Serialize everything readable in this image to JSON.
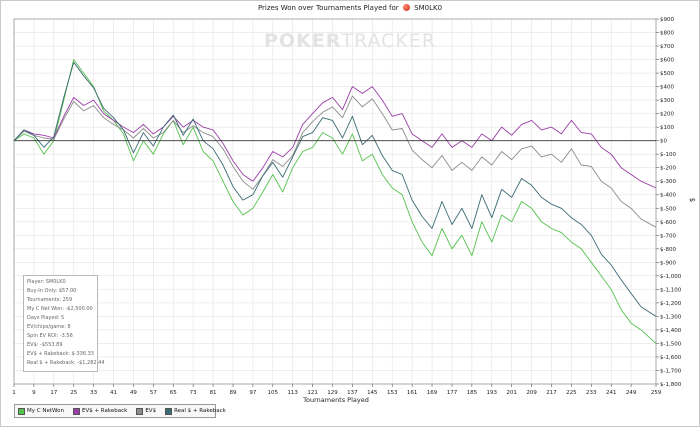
{
  "title": "Prizes Won over Tournaments Played for",
  "player_name": "SM0LK0",
  "watermark": {
    "part1": "POKER",
    "part2": "TRACKER"
  },
  "y_axis_label": "$",
  "x_axis_label": "Tournaments Played",
  "info_box": [
    "Player: SM0LK0",
    "Buy-In Only: $57.00",
    "Tournaments: 259",
    "My C Net Won: -$2,500.00",
    "Days Played: 5",
    "EV/chips/game: 8",
    "Spin EV ROI: -3.56",
    "EV$: -$553.89",
    "EV$ + Rakeback: $-336.33",
    "Real $ + Rakeback: -$1,282.44"
  ],
  "colors": {
    "green": "#55c24e",
    "purple": "#9a3ea6",
    "gray": "#8c8c8c",
    "teal": "#3a6a74",
    "zero_line": "#333333",
    "grid": "#e3e3e3"
  },
  "chart_data": {
    "type": "line",
    "title": "Prizes Won over Tournaments Played for SM0LK0",
    "xlabel": "Tournaments Played",
    "ylabel": "$",
    "xlim": [
      1,
      259
    ],
    "ylim": [
      -1800,
      900
    ],
    "x_ticks": [
      1,
      9,
      17,
      25,
      33,
      41,
      49,
      57,
      65,
      73,
      81,
      89,
      97,
      105,
      113,
      121,
      129,
      137,
      145,
      153,
      161,
      169,
      177,
      185,
      193,
      201,
      209,
      217,
      225,
      233,
      241,
      249,
      259
    ],
    "y_ticks": [
      900,
      800,
      700,
      600,
      500,
      400,
      300,
      200,
      100,
      0,
      -100,
      -200,
      -300,
      -400,
      -500,
      -600,
      -700,
      -800,
      -900,
      -1000,
      -1100,
      -1200,
      -1300,
      -1400,
      -1500,
      -1600,
      -1700,
      -1800
    ],
    "y_tick_labels": [
      "$900",
      "$800",
      "$700",
      "$600",
      "$500",
      "$400",
      "$300",
      "$200",
      "$100",
      "$0",
      "$-100",
      "$-200",
      "$-300",
      "$-400",
      "$-500",
      "$-600",
      "$-700",
      "$-800",
      "$-900",
      "$-1,000",
      "$-1,100",
      "$-1,200",
      "$-1,300",
      "$-1,400",
      "$-1,500",
      "$-1,600",
      "$-1,700",
      "$-1,800"
    ],
    "grid": true,
    "legend_position": "bottom-left",
    "series": [
      {
        "name": "My C NetWon",
        "color": "#55c24e",
        "x": [
          1,
          5,
          9,
          13,
          17,
          21,
          25,
          29,
          33,
          37,
          41,
          45,
          49,
          53,
          57,
          61,
          65,
          69,
          73,
          77,
          81,
          85,
          89,
          93,
          97,
          101,
          105,
          109,
          113,
          117,
          121,
          125,
          129,
          133,
          137,
          141,
          145,
          149,
          153,
          157,
          161,
          165,
          169,
          173,
          177,
          181,
          185,
          189,
          193,
          197,
          201,
          205,
          209,
          213,
          217,
          221,
          225,
          229,
          233,
          237,
          241,
          245,
          249,
          253,
          259
        ],
        "y": [
          0,
          50,
          20,
          -100,
          0,
          300,
          600,
          500,
          400,
          220,
          150,
          50,
          -150,
          0,
          -100,
          50,
          150,
          -30,
          100,
          -80,
          -150,
          -300,
          -450,
          -550,
          -500,
          -380,
          -250,
          -380,
          -200,
          -80,
          -50,
          60,
          20,
          -100,
          50,
          -150,
          -100,
          -250,
          -350,
          -400,
          -600,
          -750,
          -850,
          -650,
          -800,
          -700,
          -850,
          -600,
          -750,
          -550,
          -600,
          -450,
          -500,
          -600,
          -650,
          -680,
          -750,
          -800,
          -900,
          -1000,
          -1100,
          -1250,
          -1350,
          -1400,
          -1500
        ]
      },
      {
        "name": "EV$ + Rakeback",
        "color": "#9a3ea6",
        "x": [
          1,
          5,
          9,
          13,
          17,
          21,
          25,
          29,
          33,
          37,
          41,
          45,
          49,
          53,
          57,
          61,
          65,
          69,
          73,
          77,
          81,
          85,
          89,
          93,
          97,
          101,
          105,
          109,
          113,
          117,
          121,
          125,
          129,
          133,
          137,
          141,
          145,
          149,
          153,
          157,
          161,
          165,
          169,
          173,
          177,
          181,
          185,
          189,
          193,
          197,
          201,
          205,
          209,
          213,
          217,
          221,
          225,
          229,
          233,
          237,
          241,
          245,
          249,
          253,
          259
        ],
        "y": [
          0,
          80,
          50,
          40,
          20,
          180,
          320,
          260,
          300,
          200,
          150,
          100,
          60,
          120,
          50,
          100,
          180,
          100,
          150,
          100,
          80,
          -20,
          -150,
          -250,
          -300,
          -200,
          -80,
          -120,
          -50,
          120,
          200,
          280,
          320,
          230,
          400,
          350,
          400,
          300,
          180,
          200,
          50,
          0,
          -50,
          50,
          -50,
          0,
          -50,
          50,
          0,
          100,
          40,
          120,
          150,
          80,
          100,
          50,
          150,
          60,
          50,
          -50,
          -100,
          -200,
          -250,
          -300,
          -350
        ]
      },
      {
        "name": "EV$",
        "color": "#8c8c8c",
        "x": [
          1,
          5,
          9,
          13,
          17,
          21,
          25,
          29,
          33,
          37,
          41,
          45,
          49,
          53,
          57,
          61,
          65,
          69,
          73,
          77,
          81,
          85,
          89,
          93,
          97,
          101,
          105,
          109,
          113,
          117,
          121,
          125,
          129,
          133,
          137,
          141,
          145,
          149,
          153,
          157,
          161,
          165,
          169,
          173,
          177,
          181,
          185,
          189,
          193,
          197,
          201,
          205,
          209,
          213,
          217,
          221,
          225,
          229,
          233,
          237,
          241,
          245,
          249,
          253,
          259
        ],
        "y": [
          0,
          70,
          40,
          20,
          10,
          160,
          290,
          220,
          260,
          170,
          120,
          80,
          20,
          90,
          20,
          60,
          150,
          60,
          110,
          60,
          30,
          -60,
          -190,
          -300,
          -360,
          -260,
          -140,
          -190,
          -110,
          60,
          140,
          210,
          250,
          170,
          330,
          250,
          310,
          200,
          80,
          90,
          -70,
          -140,
          -200,
          -110,
          -220,
          -160,
          -220,
          -120,
          -180,
          -80,
          -140,
          -60,
          -40,
          -120,
          -100,
          -160,
          -60,
          -180,
          -190,
          -300,
          -350,
          -450,
          -500,
          -580,
          -640
        ]
      },
      {
        "name": "Real $ + Rakeback",
        "color": "#3a6a74",
        "x": [
          1,
          5,
          9,
          13,
          17,
          21,
          25,
          29,
          33,
          37,
          41,
          45,
          49,
          53,
          57,
          61,
          65,
          69,
          73,
          77,
          81,
          85,
          89,
          93,
          97,
          101,
          105,
          109,
          113,
          117,
          121,
          125,
          129,
          133,
          137,
          141,
          145,
          149,
          153,
          157,
          161,
          165,
          169,
          173,
          177,
          181,
          185,
          189,
          193,
          197,
          201,
          205,
          209,
          213,
          217,
          221,
          225,
          229,
          233,
          237,
          241,
          245,
          249,
          253,
          259
        ],
        "y": [
          0,
          80,
          40,
          -50,
          30,
          320,
          580,
          480,
          390,
          240,
          170,
          80,
          -90,
          60,
          -40,
          100,
          190,
          40,
          160,
          0,
          -60,
          -180,
          -340,
          -440,
          -400,
          -260,
          -160,
          -270,
          -120,
          30,
          60,
          170,
          150,
          20,
          180,
          -30,
          40,
          -110,
          -220,
          -250,
          -440,
          -560,
          -650,
          -450,
          -620,
          -500,
          -650,
          -400,
          -570,
          -360,
          -420,
          -280,
          -330,
          -420,
          -470,
          -500,
          -570,
          -620,
          -700,
          -840,
          -920,
          -1030,
          -1130,
          -1230,
          -1300
        ]
      }
    ]
  }
}
